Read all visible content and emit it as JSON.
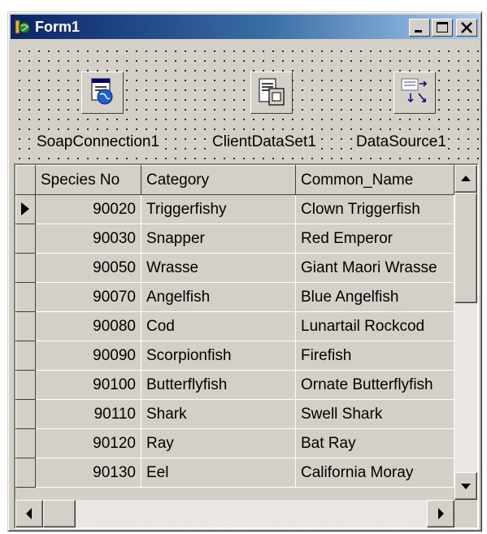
{
  "window": {
    "title": "Form1",
    "icon": "delphi-form-icon",
    "buttons": [
      "minimize-icon",
      "maximize-icon",
      "close-icon"
    ]
  },
  "components": [
    {
      "name": "SoapConnection1",
      "icon": "soap-connection-icon"
    },
    {
      "name": "ClientDataSet1",
      "icon": "client-dataset-icon"
    },
    {
      "name": "DataSource1",
      "icon": "datasource-icon"
    }
  ],
  "grid": {
    "columns": [
      "Species No",
      "Category",
      "Common_Name"
    ],
    "current_row_indicator": "row-pointer-icon",
    "rows": [
      {
        "species_no": "90020",
        "category": "Triggerfishy",
        "common_name": "Clown Triggerfish"
      },
      {
        "species_no": "90030",
        "category": "Snapper",
        "common_name": "Red Emperor"
      },
      {
        "species_no": "90050",
        "category": "Wrasse",
        "common_name": "Giant Maori Wrasse"
      },
      {
        "species_no": "90070",
        "category": "Angelfish",
        "common_name": "Blue Angelfish"
      },
      {
        "species_no": "90080",
        "category": "Cod",
        "common_name": "Lunartail Rockcod"
      },
      {
        "species_no": "90090",
        "category": "Scorpionfish",
        "common_name": "Firefish"
      },
      {
        "species_no": "90100",
        "category": "Butterflyfish",
        "common_name": "Ornate Butterflyfish"
      },
      {
        "species_no": "90110",
        "category": "Shark",
        "common_name": "Swell Shark"
      },
      {
        "species_no": "90120",
        "category": "Ray",
        "common_name": "Bat Ray"
      },
      {
        "species_no": "90130",
        "category": "Eel",
        "common_name": "California Moray"
      }
    ]
  },
  "colors": {
    "title_gradient_start": "#0a246a",
    "title_gradient_end": "#a6caf0",
    "face": "#d4d0c8"
  }
}
